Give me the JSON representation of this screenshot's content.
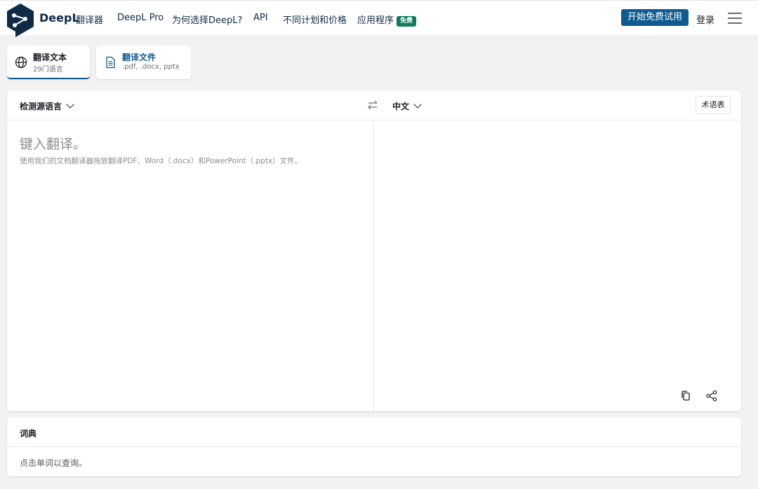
{
  "header": {
    "brand": "DeepL",
    "brand_sub": "翻译器",
    "nav": [
      {
        "label": "DeepL Pro"
      },
      {
        "label": "为何选择DeepL?"
      },
      {
        "label": "API"
      },
      {
        "label": "不同计划和价格"
      },
      {
        "label": "应用程序",
        "badge": "免费"
      }
    ],
    "cta_label": "开始免费试用",
    "login_label": "登录",
    "brand_color": "#0f2b46",
    "accent_color": "#0f5b8f",
    "badge_color": "#0f7a5c"
  },
  "mode_tabs": [
    {
      "title": "翻译文本",
      "subtitle": "29门语言",
      "icon": "globe-icon",
      "active": true
    },
    {
      "title": "翻译文件",
      "subtitle": ".pdf, .docx, pptx",
      "icon": "document-icon",
      "active": false
    }
  ],
  "translator": {
    "source_lang": "检测源语言",
    "target_lang": "中文",
    "glossary_label": "术语表",
    "placeholder": "键入翻译。",
    "hint": "使用我们的文档翻译器拖放翻译PDF、Word（.docx）和PowerPoint（.pptx）文件。",
    "icons": [
      "swap-icon",
      "copy-icon",
      "share-icon"
    ]
  },
  "dictionary": {
    "title": "词典",
    "body": "点击单词以查询。"
  }
}
